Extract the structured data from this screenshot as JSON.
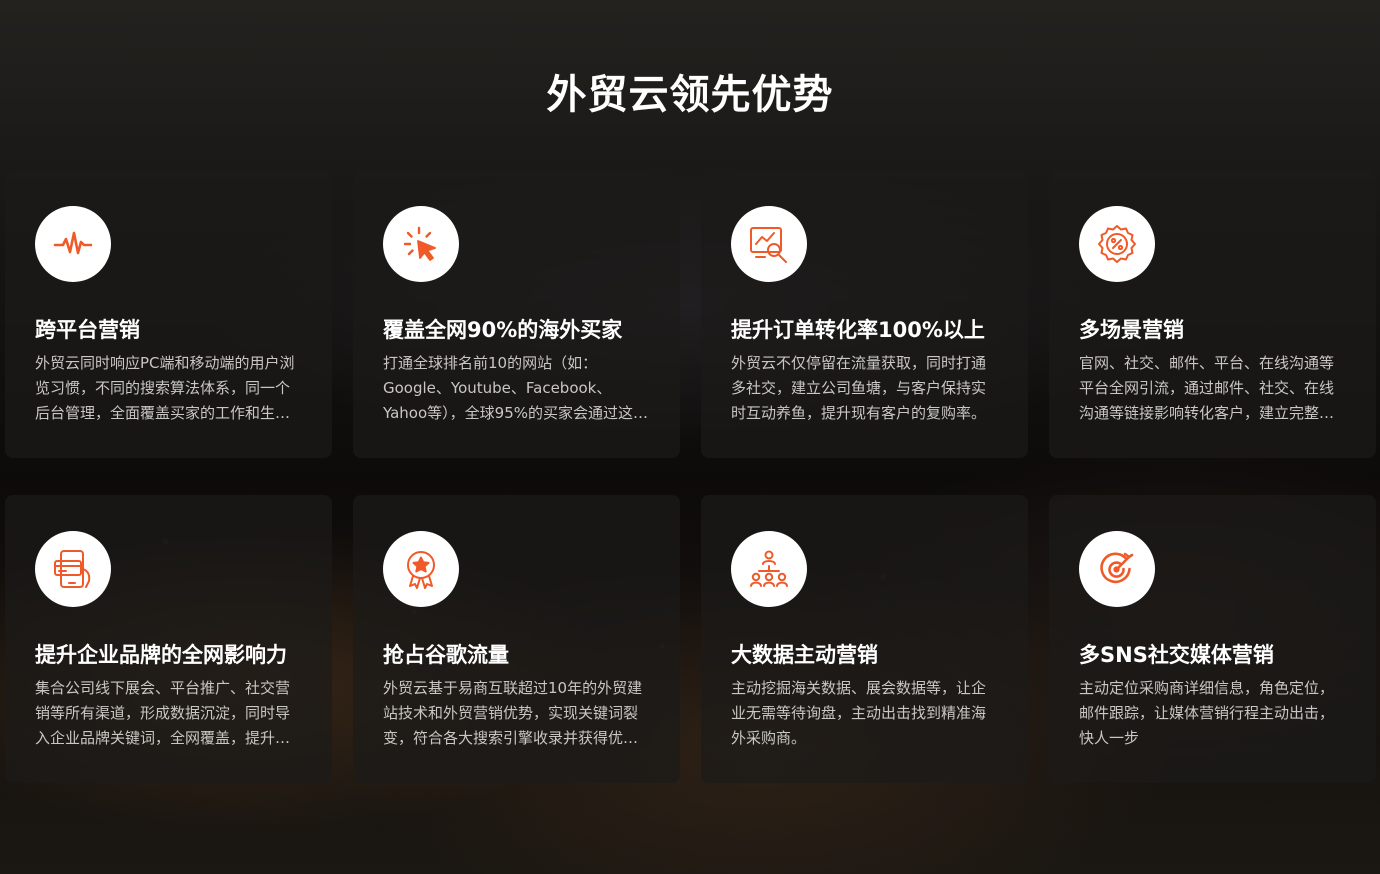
{
  "section": {
    "title": "外贸云领先优势"
  },
  "colors": {
    "accent": "#f05a28",
    "card_bg": "#1c1a19",
    "desc_text": "#c9c6c3"
  },
  "cards": [
    {
      "icon": "pulse-icon",
      "title": "跨平台营销",
      "desc": "外贸云同时响应PC端和移动端的用户浏览习惯，不同的搜索算法体系，同一个后台管理，全面覆盖买家的工作和生活场景。"
    },
    {
      "icon": "cursor-click-icon",
      "title": "覆盖全网90%的海外买家",
      "desc": "打通全球排名前10的网站（如：Google、Youtube、Facebook、Yahoo等），全球95%的买家会通过这些渠道寻找供应商。"
    },
    {
      "icon": "chart-analysis-icon",
      "title": "提升订单转化率100%以上",
      "desc": "外贸云不仅停留在流量获取，同时打通多社交，建立公司鱼塘，与客户保持实时互动养鱼，提升现有客户的复购率。"
    },
    {
      "icon": "discount-badge-icon",
      "title": "多场景营销",
      "desc": "官网、社交、邮件、平台、在线沟通等平台全网引流，通过邮件、社交、在线沟通等链接影响转化客户，建立完整营销闭环。"
    },
    {
      "icon": "mobile-payment-icon",
      "title": "提升企业品牌的全网影响力",
      "desc": "集合公司线下展会、平台推广、社交营销等所有渠道，形成数据沉淀，同时导入企业品牌关键词，全网覆盖，提升企业品牌影响力。"
    },
    {
      "icon": "award-star-icon",
      "title": "抢占谷歌流量",
      "desc": "外贸云基于易商互联超过10年的外贸建站技术和外贸营销优势，实现关键词裂变，符合各大搜索引擎收录并获得优质排名。"
    },
    {
      "icon": "network-users-icon",
      "title": "大数据主动营销",
      "desc": "主动挖掘海关数据、展会数据等，让企业无需等待询盘，主动出击找到精准海外采购商。"
    },
    {
      "icon": "target-icon",
      "title": "多SNS社交媒体营销",
      "desc": "主动定位采购商详细信息，角色定位，邮件跟踪，让媒体营销行程主动出击，快人一步"
    }
  ]
}
